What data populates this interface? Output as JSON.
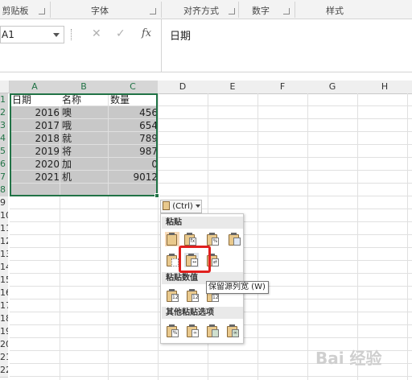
{
  "ribbon": {
    "groups": [
      "剪贴板",
      "字体",
      "对齐方式",
      "数字",
      "样式"
    ]
  },
  "formula_bar": {
    "name_box": "A1",
    "cancel_glyph": "✕",
    "enter_glyph": "✓",
    "fx_label": "fx",
    "formula_value": "日期"
  },
  "sheet": {
    "columns": [
      "A",
      "B",
      "C",
      "D",
      "E",
      "F",
      "G",
      "H"
    ],
    "row_numbers": [
      "1",
      "2",
      "3",
      "4",
      "5",
      "6",
      "7",
      "8",
      "9",
      "10",
      "11",
      "12",
      "13",
      "14",
      "15",
      "16",
      "17",
      "18",
      "19",
      "20",
      "21",
      "22"
    ],
    "headers": [
      "日期",
      "名称",
      "数量"
    ],
    "rows": [
      {
        "date": "2016",
        "name": "噢",
        "qty": "456"
      },
      {
        "date": "2017",
        "name": "哦",
        "qty": "654"
      },
      {
        "date": "2018",
        "name": "就",
        "qty": "789"
      },
      {
        "date": "2019",
        "name": "将",
        "qty": "987"
      },
      {
        "date": "2020",
        "name": "加",
        "qty": "0"
      },
      {
        "date": "2021",
        "name": "机",
        "qty": "9012"
      }
    ]
  },
  "paste_popup": {
    "ctrl_label": "(Ctrl)",
    "section_paste": "粘贴",
    "section_values": "粘贴数值",
    "section_other": "其他粘贴选项",
    "tooltip": "保留源列宽 (W)",
    "icons": {
      "row1": [
        "paste-icon",
        "formulas-icon",
        "formulas-number-format-icon",
        "keep-source-formatting-icon"
      ],
      "row2": [
        "no-borders-icon",
        "keep-source-column-widths-icon",
        "transpose-icon"
      ],
      "row3": [
        "values-icon",
        "values-number-format-icon",
        "values-source-formatting-icon"
      ],
      "row4": [
        "formatting-icon",
        "paste-link-icon",
        "picture-icon",
        "linked-picture-icon"
      ]
    },
    "icon_labels": {
      "fx": "fx",
      "pct": "%",
      "v123": "123"
    },
    "highlight_color": "#e0201e"
  },
  "watermark": "Bai 经验"
}
